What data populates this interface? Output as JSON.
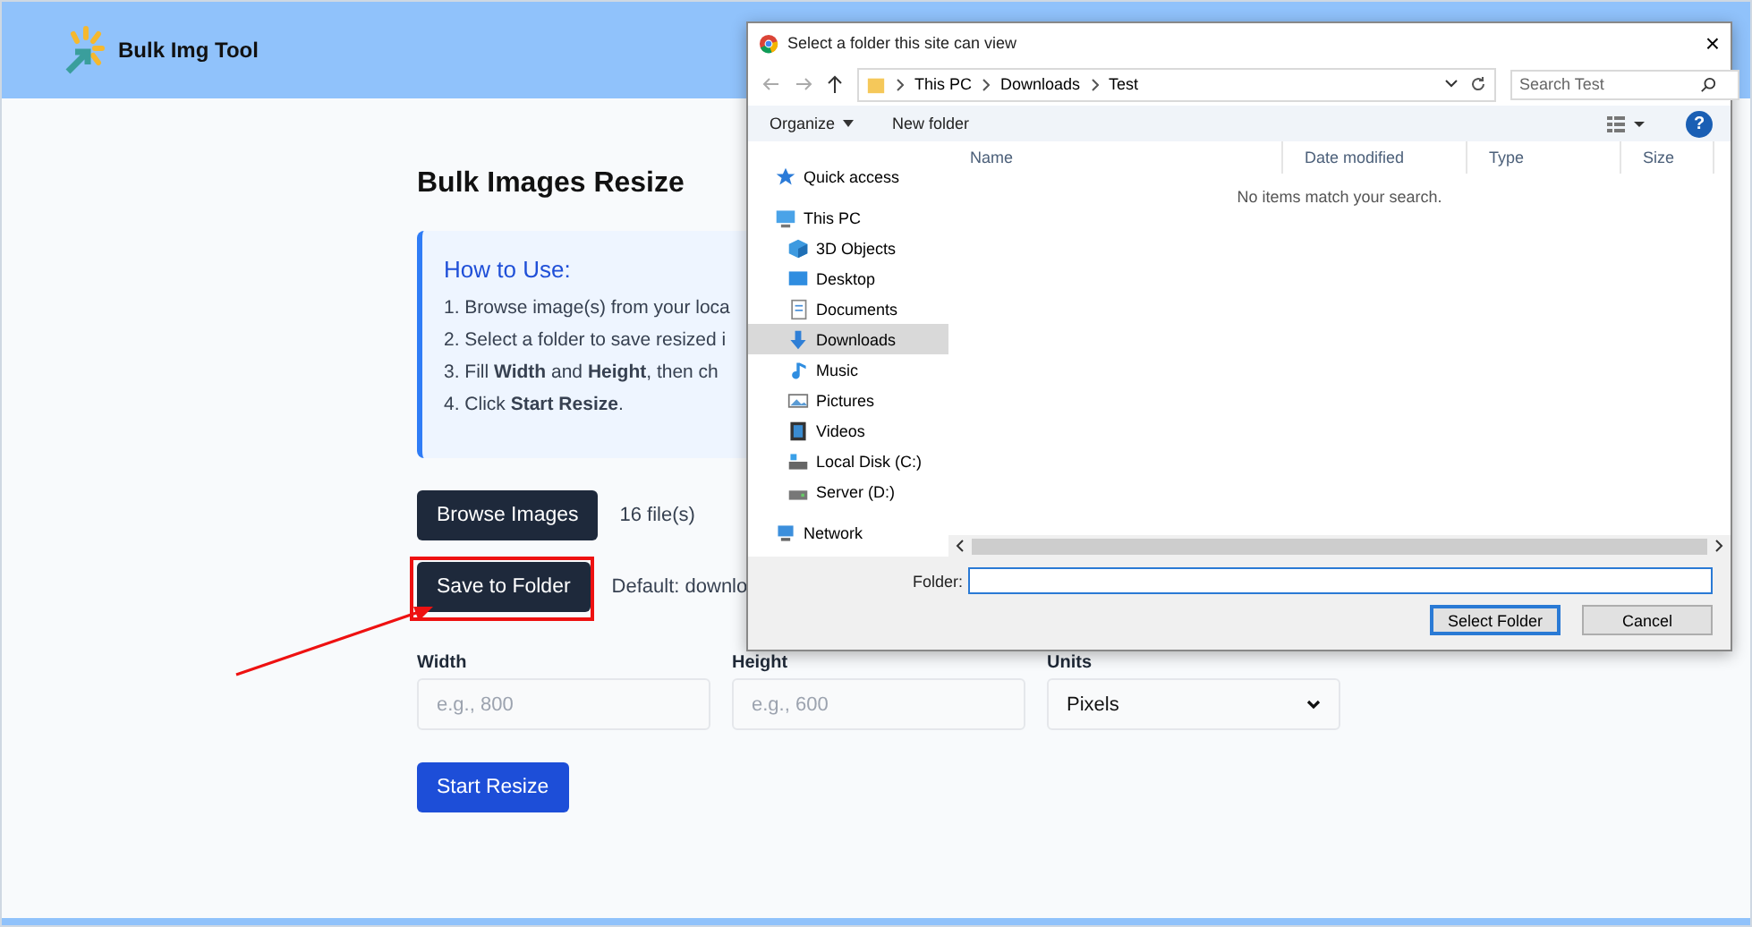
{
  "header": {
    "brand": "Bulk Img Tool"
  },
  "main": {
    "title": "Bulk Images Resize",
    "help": {
      "title": "How to Use:",
      "steps": [
        "1. Browse image(s) from your loca",
        "2. Select a folder to save resized i",
        "3. Fill **Width** and **Height**, then ch",
        "4. Click **Start Resize**."
      ]
    },
    "browse": {
      "button": "Browse Images",
      "status": "16 file(s)"
    },
    "save": {
      "button": "Save to Folder",
      "status": "Default: downlo",
      "highlighted": true
    },
    "fields": [
      {
        "kind": "input",
        "label": "Width",
        "placeholder": "e.g., 800"
      },
      {
        "kind": "input",
        "label": "Height",
        "placeholder": "e.g., 600"
      },
      {
        "kind": "select",
        "label": "Units",
        "value": "Pixels"
      }
    ],
    "submit": "Start Resize"
  },
  "dialog": {
    "title": "Select a folder this site can view",
    "close": "×",
    "path": [
      "This PC",
      "Downloads",
      "Test"
    ],
    "search": {
      "placeholder": "Search Test"
    },
    "toolbar": {
      "organize": "Organize",
      "new_folder": "New folder",
      "help": "?"
    },
    "nav": [
      {
        "label": "Quick access",
        "selected": false
      },
      {
        "label": "This PC",
        "selected": false,
        "children": [
          {
            "label": "3D Objects",
            "selected": false
          },
          {
            "label": "Desktop",
            "selected": false
          },
          {
            "label": "Documents",
            "selected": false
          },
          {
            "label": "Downloads",
            "selected": true
          },
          {
            "label": "Music",
            "selected": false
          },
          {
            "label": "Pictures",
            "selected": false
          },
          {
            "label": "Videos",
            "selected": false
          },
          {
            "label": "Local Disk (C:)",
            "selected": false
          },
          {
            "label": "Server (D:)",
            "selected": false
          }
        ]
      },
      {
        "label": "Network",
        "selected": false
      }
    ],
    "columns": [
      "Name",
      "Date modified",
      "Type",
      "Size"
    ],
    "empty": "No items match your search.",
    "folder_label": "Folder:",
    "buttons": [
      {
        "label": "Select Folder",
        "default": true
      },
      {
        "label": "Cancel",
        "default": false
      }
    ]
  }
}
